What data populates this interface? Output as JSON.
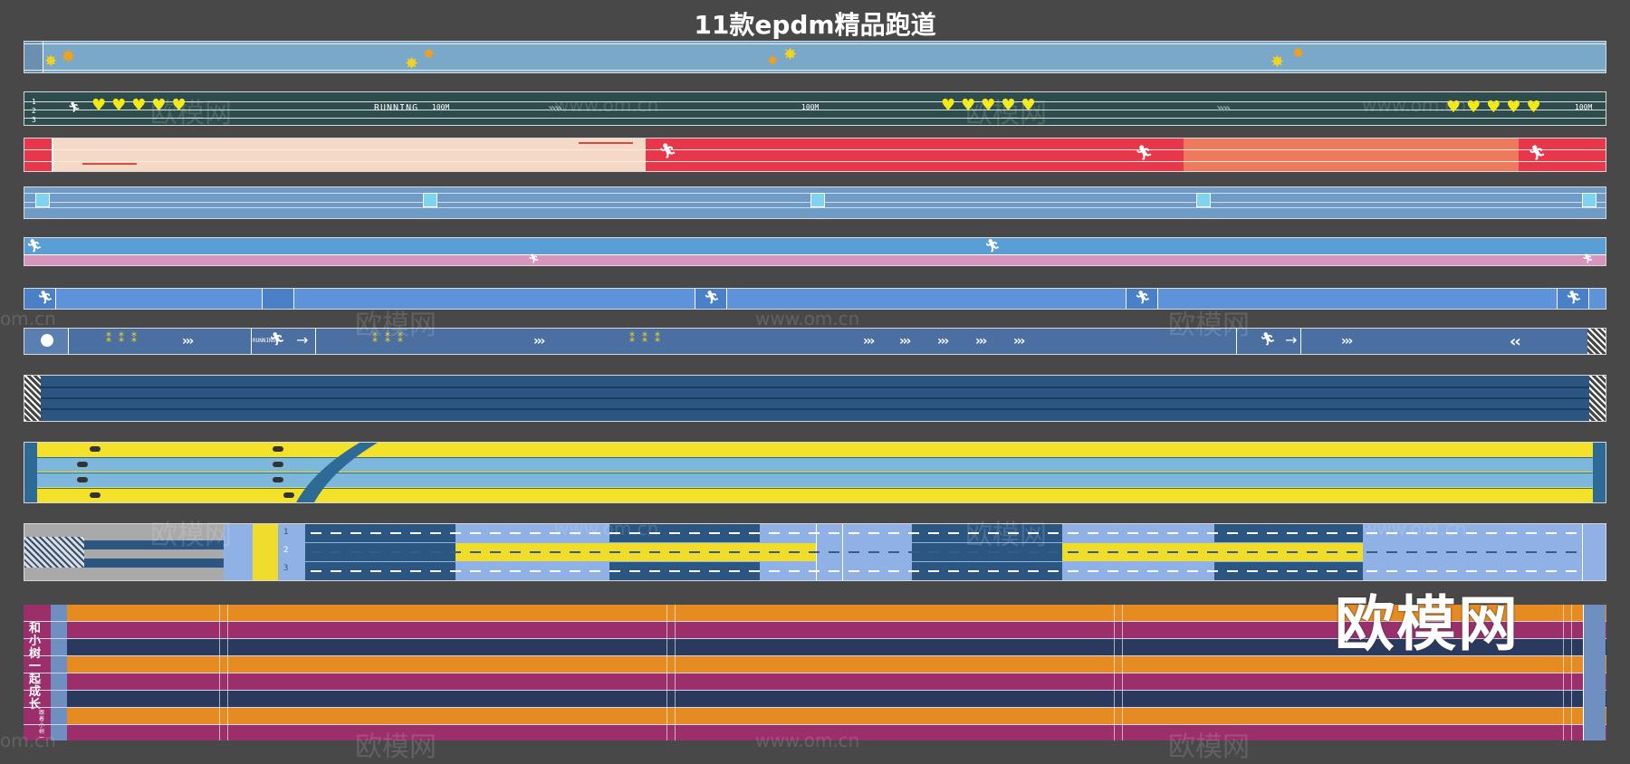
{
  "page": {
    "title": "11款epdm精品跑道",
    "background": "#484848"
  },
  "watermarks": {
    "brand": "欧模网",
    "url": "www.om.cn",
    "url_short": "om.cn",
    "logo": "欧模网"
  },
  "tracks": [
    {
      "id": 1,
      "style": "autumn-leaves",
      "base_color": "#7aa8c8"
    },
    {
      "id": 2,
      "style": "hearts-dark-teal",
      "base_color": "#2f4c4c",
      "label": "RUNNING",
      "distance_mark": "100M",
      "lane_numbers": [
        "1",
        "2",
        "3"
      ]
    },
    {
      "id": 3,
      "style": "peach-red-coral",
      "colors": [
        "#f5d9c7",
        "#e8364a",
        "#ee7a5e"
      ]
    },
    {
      "id": 4,
      "style": "blue-lanes-markers",
      "base_color": "#6f9cc6"
    },
    {
      "id": 5,
      "style": "blue-pink-two-lane",
      "colors": [
        "#5a9ed6",
        "#d595bd"
      ]
    },
    {
      "id": 6,
      "style": "bright-blue-runner",
      "base_color": "#5d93db"
    },
    {
      "id": 7,
      "style": "blue-footprints-arrows",
      "base_color": "#4b6fa0",
      "label": "RUNNING"
    },
    {
      "id": 8,
      "style": "navy-stripes",
      "base_color": "#2c5682"
    },
    {
      "id": 9,
      "style": "yellow-skyblue-curve",
      "colors": [
        "#f4e12a",
        "#7db8dc",
        "#2e6a96"
      ]
    },
    {
      "id": 10,
      "style": "yellow-navy-skyblue-blocks",
      "colors": [
        "#2c5682",
        "#f0dc2a",
        "#8fb1e6"
      ],
      "lane_numbers": [
        "1",
        "2",
        "3"
      ]
    },
    {
      "id": 11,
      "style": "orange-magenta-navy-lanes",
      "colors": [
        "#e68a22",
        "#9a2f6c",
        "#2a3a5e"
      ],
      "banner": "和小树一起成长",
      "banner_sub": "跟着小树一起奔跑"
    }
  ]
}
